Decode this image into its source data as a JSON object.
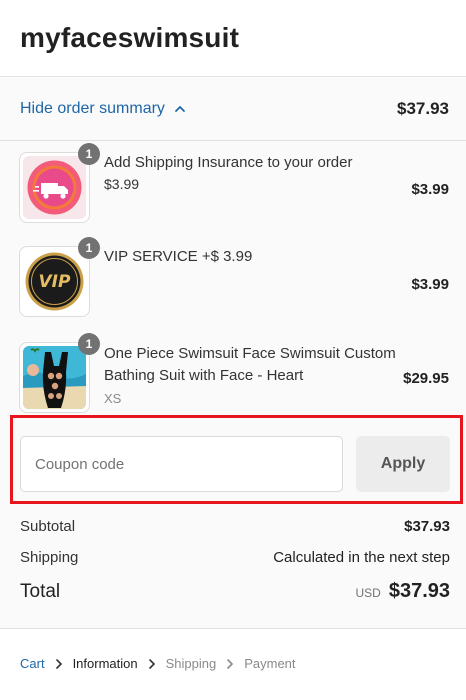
{
  "store": {
    "name": "myfaceswimsuit"
  },
  "summary_toggle": {
    "label": "Hide order summary",
    "total": "$37.93"
  },
  "products": [
    {
      "title": "Add Shipping Insurance to your order",
      "subtitle": "$3.99",
      "price": "$3.99",
      "quantity": "1",
      "image": "shipping-insurance-image"
    },
    {
      "title": "VIP SERVICE +$ 3.99",
      "price": "$3.99",
      "quantity": "1",
      "image": "vip-service-image",
      "image_text": "VIP"
    },
    {
      "title_line1": "One Piece Swimsuit Face Swimsuit Custom",
      "title_line2": "Bathing Suit with Face - Heart",
      "variant": "XS",
      "price": "$29.95",
      "quantity": "1",
      "image": "swimsuit-image"
    }
  ],
  "coupon": {
    "placeholder": "Coupon code",
    "apply_label": "Apply"
  },
  "totals": {
    "subtotal_label": "Subtotal",
    "subtotal_value": "$37.93",
    "shipping_label": "Shipping",
    "shipping_value": "Calculated in the next step",
    "total_label": "Total",
    "currency": "USD",
    "total_value": "$37.93"
  },
  "breadcrumb": {
    "cart": "Cart",
    "information": "Information",
    "shipping": "Shipping",
    "payment": "Payment"
  },
  "colors": {
    "link": "#1f66a8",
    "highlight": "#e8141e",
    "summary_bg": "#fafafa",
    "badge": "#727272"
  }
}
